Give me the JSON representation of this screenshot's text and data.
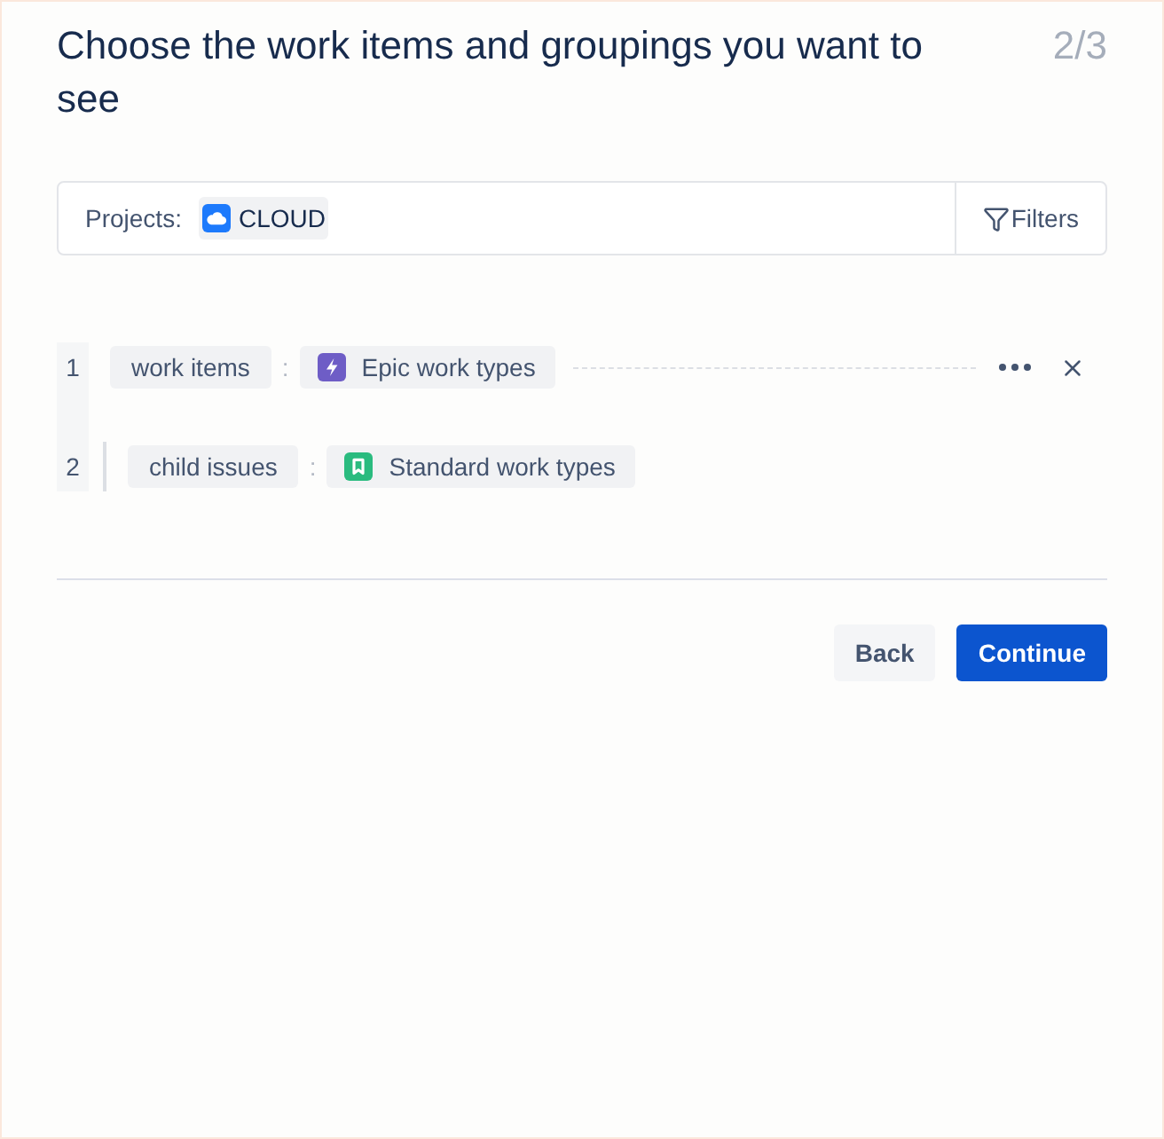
{
  "header": {
    "title": "Choose the work items and groupings you want to see",
    "step": "2/3"
  },
  "filter_bar": {
    "label": "Projects:",
    "projects": [
      {
        "name": "CLOUD"
      }
    ],
    "filters_button": "Filters"
  },
  "levels": [
    {
      "number": "1",
      "field": "work items",
      "separator": ":",
      "type": {
        "label": "Epic work types",
        "kind": "epic",
        "color": "#6e5dc6"
      },
      "hovered": true,
      "children": [
        {
          "number": "2",
          "field": "child issues",
          "separator": ":",
          "type": {
            "label": "Standard work types",
            "kind": "standard",
            "color": "#2abb7f"
          },
          "hovered": false
        }
      ]
    }
  ],
  "buttons": {
    "back": "Back",
    "continue": "Continue"
  }
}
